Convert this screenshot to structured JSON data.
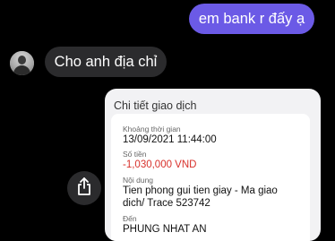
{
  "chat": {
    "outgoing_message": "em bank r đấy ạ",
    "incoming_message": "Cho anh địa chỉ"
  },
  "receipt": {
    "title": "Chi tiết giao dịch",
    "time_label": "Khoảng thời gian",
    "time_value": "13/09/2021 11:44:00",
    "amount_label": "Số tiền",
    "amount_value": "-1,030,000 VND",
    "content_label": "Nội dung",
    "content_line1": "Tien phong gui tien giay - Ma giao",
    "content_line2": "dich/ Trace 523742",
    "to_label": "Đến",
    "to_value": "PHUNG NHAT AN"
  },
  "icons": {
    "share": "share-icon",
    "avatar": "avatar"
  },
  "colors": {
    "outgoing_bubble": "#6b5ae6",
    "incoming_bubble": "#2b2b2d",
    "amount_negative": "#d8312b"
  }
}
